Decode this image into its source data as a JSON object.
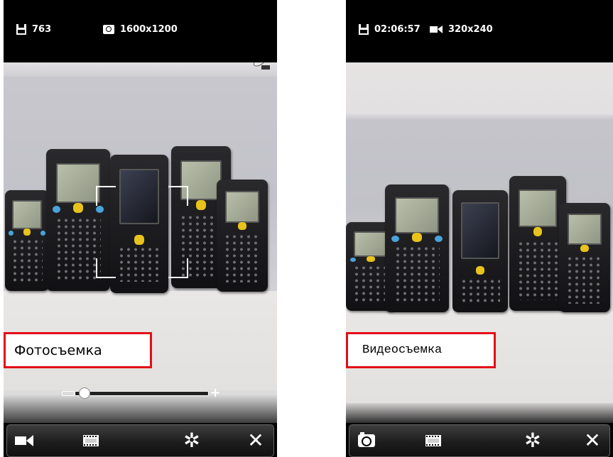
{
  "left_screen": {
    "status": {
      "storage_value": "763",
      "resolution": "1600x1200"
    },
    "mode_label": "Фотосъемка",
    "toolbar": {
      "icons": [
        "video-icon",
        "film-icon",
        "gear-icon",
        "close-icon"
      ]
    }
  },
  "right_screen": {
    "status": {
      "storage_value": "02:06:57",
      "resolution": "320x240"
    },
    "mode_label": "Видеосъемка",
    "toolbar": {
      "icons": [
        "camera-icon",
        "film-icon",
        "gear-icon",
        "close-icon"
      ]
    }
  },
  "glyphs": {
    "gear": "✲",
    "close": "✕",
    "plus": "+"
  },
  "colors": {
    "highlight_border": "#e20e17",
    "background": "#000000"
  }
}
